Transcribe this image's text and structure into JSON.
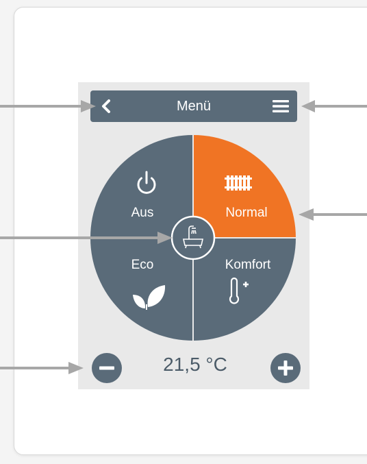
{
  "header": {
    "title": "Menü"
  },
  "modes": {
    "off": {
      "label": "Aus",
      "icon": "power-icon"
    },
    "normal": {
      "label": "Normal",
      "icon": "radiator-icon",
      "active": true
    },
    "eco": {
      "label": "Eco",
      "icon": "leaf-icon"
    },
    "comfort": {
      "label": "Komfort",
      "icon": "thermometer-plus-icon"
    },
    "center": {
      "icon": "bathtub-shower-icon"
    }
  },
  "temperature": {
    "value": "21,5 °C"
  },
  "colors": {
    "panel": "#5a6b79",
    "active": "#f07424",
    "device_bg": "#e9e9e9",
    "arrow": "#a7a7a7"
  }
}
